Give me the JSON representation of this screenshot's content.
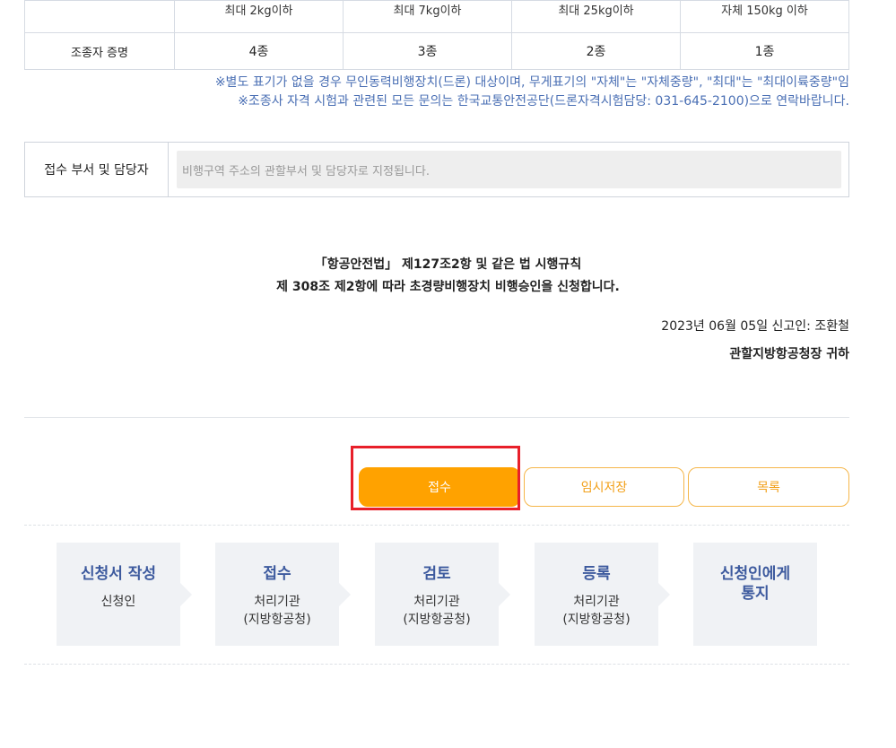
{
  "weight_table": {
    "top_row": [
      "최대 2kg이하",
      "최대 7kg이하",
      "최대 25kg이하",
      "자체 150kg 이하"
    ],
    "cert_row": {
      "label": "조종자 증명",
      "values": [
        "4종",
        "3종",
        "2종",
        "1종"
      ]
    }
  },
  "notes": {
    "line1": "※별도 표기가 없을 경우 무인동력비행장치(드론) 대상이며, 무게표기의 \"자체\"는 \"자체중량\", \"최대\"는 \"최대이륙중량\"임",
    "line2": "※조종사 자격 시험과 관련된 모든 문의는 한국교통안전공단(드론자격시험담당: 031-645-2100)으로 연락바랍니다."
  },
  "receiver": {
    "label": "접수 부서 및 담당자",
    "placeholder": "비행구역 주소의 관할부서 및 담당자로 지정됩니다."
  },
  "statement": {
    "line1": "「항공안전법」 제127조2항 및 같은 법 시행규칙",
    "line2": "제 308조 제2항에 따라 초경량비행장치 비행승인을 신청합니다."
  },
  "signature": {
    "date_applicant": "2023년 06월 05일 신고인: 조환철",
    "addressee": "관할지방항공청장 귀하"
  },
  "buttons": {
    "submit": "접수",
    "temp_save": "임시저장",
    "list": "목록"
  },
  "process_steps": [
    {
      "title": "신청서 작성",
      "sub": "신청인"
    },
    {
      "title": "접수",
      "sub": "처리기관\n(지방항공청)"
    },
    {
      "title": "검토",
      "sub": "처리기관\n(지방항공청)"
    },
    {
      "title": "등록",
      "sub": "처리기관\n(지방항공청)"
    },
    {
      "title": "신청인에게\n통지",
      "sub": ""
    }
  ],
  "colors": {
    "accent": "#ffa200",
    "step_title": "#3d5a9e",
    "note_text": "#4a6fb4",
    "highlight": "#e8202a"
  }
}
